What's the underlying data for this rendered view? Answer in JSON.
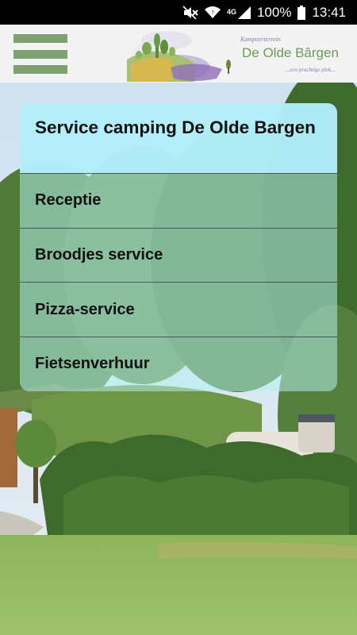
{
  "status_bar": {
    "network_label": "4G",
    "battery_percent": "100%",
    "time": "13:41",
    "icons": [
      "mute-icon",
      "wifi-icon",
      "cell-signal-icon",
      "battery-icon"
    ]
  },
  "header": {
    "menu_icon": "hamburger-icon",
    "logo": {
      "subtitle": "Kampeerterrein",
      "name": "De Olde Bârgen",
      "tagline": "...een prachtige plek..."
    }
  },
  "menu": {
    "title": "Service camping De Olde Bargen",
    "items": [
      {
        "label": "Receptie"
      },
      {
        "label": "Broodjes service"
      },
      {
        "label": "Pizza-service"
      },
      {
        "label": "Fietsenverhuur"
      }
    ]
  },
  "colors": {
    "accent_green": "#7fa070",
    "title_bg": "#b2eefa",
    "item_bg": "#b2eeeb"
  }
}
